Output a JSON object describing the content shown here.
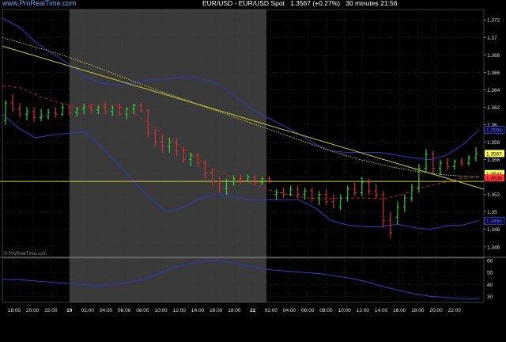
{
  "header": {
    "link": "www.ProRealTime.com",
    "title": "EUR/USD - EUR/USD Spot",
    "last": "1.3567",
    "change": "(+0.27%)",
    "interval": "30 minutes",
    "time": "21:56"
  },
  "watermark": "© ProRealTime.com",
  "y_ticks": [
    "1.372",
    "1.37",
    "1.368",
    "1.366",
    "1.364",
    "1.362",
    "1.36",
    "1.358",
    "1.356",
    "1.354",
    "1.352",
    "1.35",
    "1.348",
    "1.346"
  ],
  "y_tick_values": [
    1.372,
    1.37,
    1.368,
    1.366,
    1.364,
    1.362,
    1.36,
    1.358,
    1.356,
    1.354,
    1.352,
    1.35,
    1.348,
    1.346
  ],
  "price_labels": [
    {
      "text": "1.3567",
      "value": 1.3567,
      "bg": "#ffff66",
      "fg": "#000000"
    },
    {
      "text": "1.3544",
      "value": 1.3544,
      "bg": "#ffff66",
      "fg": "#000000"
    },
    {
      "text": "1.3539",
      "value": 1.3539,
      "bg": "#ff3333",
      "fg": "#000000"
    },
    {
      "text": "1.3594",
      "value": 1.3594,
      "bg": "#000033",
      "fg": "#6666ff"
    },
    {
      "text": "1.3490",
      "value": 1.349,
      "bg": "#000033",
      "fg": "#6666ff"
    }
  ],
  "x_ticks": [
    "18:00",
    "20:00",
    "22:00",
    "19",
    "02:00",
    "04:00",
    "06:00",
    "08:00",
    "10:00",
    "12:00",
    "14:00",
    "16:00",
    "18:00",
    "22",
    "02:00",
    "04:00",
    "06:00",
    "08:00",
    "10:00",
    "12:00",
    "14:00",
    "16:00",
    "18:00",
    "20:00",
    "22:00"
  ],
  "x_tick_bold": [
    false,
    false,
    false,
    true,
    false,
    false,
    false,
    false,
    false,
    false,
    false,
    false,
    false,
    true,
    false,
    false,
    false,
    false,
    false,
    false,
    false,
    false,
    false,
    false,
    false
  ],
  "osc_ticks": [
    "60",
    "50",
    "40",
    "30"
  ],
  "osc_tick_values": [
    60,
    50,
    40,
    30
  ],
  "colors": {
    "up": "#33cc33",
    "down": "#cc3333",
    "bollinger": "#3333bb",
    "moving_average": "#aa2222",
    "trendline": "#cccc33",
    "dotted_ma": "#cccc33",
    "weekend_shade": "#3a3a3a",
    "grid": "#333333"
  },
  "chart_data": {
    "type": "candlestick",
    "instrument": "EUR/USD",
    "interval": "30 minutes",
    "ylim": [
      1.3448,
      1.3732
    ],
    "horizontal_line": 1.3535,
    "bollinger_upper": [
      1.3722,
      1.3712,
      1.3695,
      1.3682,
      1.367,
      1.3655,
      1.3648,
      1.3645,
      1.3648,
      1.3651,
      1.3652,
      1.3655,
      1.3653,
      1.3648,
      1.3635,
      1.362,
      1.3609,
      1.36,
      1.359,
      1.3578,
      1.357,
      1.3568,
      1.3568,
      1.3568,
      1.3565,
      1.3562,
      1.356,
      1.3565,
      1.3577,
      1.3594
    ],
    "bollinger_lower": [
      1.3612,
      1.3596,
      1.3585,
      1.3588,
      1.359,
      1.3592,
      1.3575,
      1.3555,
      1.3535,
      1.3515,
      1.35,
      1.3505,
      1.3516,
      1.352,
      1.3518,
      1.3514,
      1.3514,
      1.3514,
      1.3514,
      1.3505,
      1.349,
      1.3485,
      1.3483,
      1.3483,
      1.3486,
      1.3482,
      1.348,
      1.3484,
      1.3485,
      1.349
    ],
    "moving_average": [
      1.3645,
      1.3642,
      1.3632,
      1.3625,
      1.362,
      1.3623,
      1.3622,
      1.3612,
      1.3596,
      1.358,
      1.3565,
      1.355,
      1.354,
      1.3533,
      1.3525,
      1.352,
      1.3516,
      1.3515,
      1.3516,
      1.3516,
      1.3515,
      1.352,
      1.3528,
      1.3533,
      1.3538,
      1.354
    ],
    "candles": [
      {
        "o": 1.3605,
        "h": 1.3628,
        "l": 1.36,
        "c": 1.3625
      },
      {
        "o": 1.3625,
        "h": 1.3635,
        "l": 1.3615,
        "c": 1.3618
      },
      {
        "o": 1.3618,
        "h": 1.3625,
        "l": 1.3608,
        "c": 1.3612
      },
      {
        "o": 1.3612,
        "h": 1.362,
        "l": 1.3605,
        "c": 1.3615
      },
      {
        "o": 1.3615,
        "h": 1.362,
        "l": 1.3603,
        "c": 1.3608
      },
      {
        "o": 1.3608,
        "h": 1.3618,
        "l": 1.3604,
        "c": 1.361
      },
      {
        "o": 1.361,
        "h": 1.3618,
        "l": 1.3606,
        "c": 1.3614
      },
      {
        "o": 1.3614,
        "h": 1.362,
        "l": 1.3608,
        "c": 1.3612
      },
      {
        "o": 1.3612,
        "h": 1.3624,
        "l": 1.361,
        "c": 1.362
      },
      {
        "o": 1.362,
        "h": 1.3622,
        "l": 1.361,
        "c": 1.3614
      },
      {
        "o": 1.3614,
        "h": 1.362,
        "l": 1.3609,
        "c": 1.3618
      },
      {
        "o": 1.3618,
        "h": 1.3624,
        "l": 1.3612,
        "c": 1.362
      },
      {
        "o": 1.362,
        "h": 1.3624,
        "l": 1.3613,
        "c": 1.3617
      },
      {
        "o": 1.3617,
        "h": 1.3622,
        "l": 1.3612,
        "c": 1.362
      },
      {
        "o": 1.362,
        "h": 1.3626,
        "l": 1.3612,
        "c": 1.3615
      },
      {
        "o": 1.3615,
        "h": 1.3622,
        "l": 1.361,
        "c": 1.362
      },
      {
        "o": 1.362,
        "h": 1.3624,
        "l": 1.361,
        "c": 1.3612
      },
      {
        "o": 1.3612,
        "h": 1.362,
        "l": 1.3606,
        "c": 1.3618
      },
      {
        "o": 1.3618,
        "h": 1.3624,
        "l": 1.3612,
        "c": 1.3622
      },
      {
        "o": 1.3622,
        "h": 1.3626,
        "l": 1.3614,
        "c": 1.3616
      },
      {
        "o": 1.3616,
        "h": 1.3618,
        "l": 1.3585,
        "c": 1.359
      },
      {
        "o": 1.359,
        "h": 1.3595,
        "l": 1.3575,
        "c": 1.358
      },
      {
        "o": 1.358,
        "h": 1.3588,
        "l": 1.3568,
        "c": 1.3575
      },
      {
        "o": 1.3575,
        "h": 1.3585,
        "l": 1.3568,
        "c": 1.358
      },
      {
        "o": 1.358,
        "h": 1.3584,
        "l": 1.3564,
        "c": 1.357
      },
      {
        "o": 1.357,
        "h": 1.3574,
        "l": 1.3556,
        "c": 1.356
      },
      {
        "o": 1.356,
        "h": 1.3568,
        "l": 1.3552,
        "c": 1.3565
      },
      {
        "o": 1.3565,
        "h": 1.3568,
        "l": 1.3552,
        "c": 1.3556
      },
      {
        "o": 1.3556,
        "h": 1.356,
        "l": 1.3538,
        "c": 1.3545
      },
      {
        "o": 1.3545,
        "h": 1.355,
        "l": 1.353,
        "c": 1.3535
      },
      {
        "o": 1.3535,
        "h": 1.354,
        "l": 1.3522,
        "c": 1.3527
      },
      {
        "o": 1.3527,
        "h": 1.3538,
        "l": 1.352,
        "c": 1.3535
      },
      {
        "o": 1.3535,
        "h": 1.3542,
        "l": 1.353,
        "c": 1.3538
      },
      {
        "o": 1.3538,
        "h": 1.3543,
        "l": 1.3532,
        "c": 1.3536
      },
      {
        "o": 1.3536,
        "h": 1.3543,
        "l": 1.3534,
        "c": 1.354
      },
      {
        "o": 1.354,
        "h": 1.3543,
        "l": 1.3532,
        "c": 1.3534
      },
      {
        "o": 1.3534,
        "h": 1.354,
        "l": 1.3531,
        "c": 1.3538
      },
      {
        "o": 1.3538,
        "h": 1.3541,
        "l": 1.3533,
        "c": 1.3536
      },
      {
        "o": 1.352,
        "h": 1.3526,
        "l": 1.3514,
        "c": 1.3522
      },
      {
        "o": 1.3522,
        "h": 1.3528,
        "l": 1.3516,
        "c": 1.352
      },
      {
        "o": 1.352,
        "h": 1.353,
        "l": 1.3518,
        "c": 1.3526
      },
      {
        "o": 1.3526,
        "h": 1.353,
        "l": 1.3516,
        "c": 1.352
      },
      {
        "o": 1.352,
        "h": 1.3528,
        "l": 1.3514,
        "c": 1.3524
      },
      {
        "o": 1.3524,
        "h": 1.3528,
        "l": 1.3512,
        "c": 1.3516
      },
      {
        "o": 1.3516,
        "h": 1.3524,
        "l": 1.3508,
        "c": 1.352
      },
      {
        "o": 1.352,
        "h": 1.3526,
        "l": 1.3508,
        "c": 1.3512
      },
      {
        "o": 1.3512,
        "h": 1.352,
        "l": 1.3504,
        "c": 1.3506
      },
      {
        "o": 1.3506,
        "h": 1.352,
        "l": 1.3502,
        "c": 1.3516
      },
      {
        "o": 1.3516,
        "h": 1.353,
        "l": 1.3512,
        "c": 1.3526
      },
      {
        "o": 1.3526,
        "h": 1.3534,
        "l": 1.3518,
        "c": 1.3522
      },
      {
        "o": 1.3522,
        "h": 1.354,
        "l": 1.3518,
        "c": 1.3534
      },
      {
        "o": 1.3534,
        "h": 1.3538,
        "l": 1.352,
        "c": 1.3524
      },
      {
        "o": 1.3524,
        "h": 1.3532,
        "l": 1.3515,
        "c": 1.352
      },
      {
        "o": 1.352,
        "h": 1.3524,
        "l": 1.3482,
        "c": 1.349
      },
      {
        "o": 1.349,
        "h": 1.35,
        "l": 1.347,
        "c": 1.3476
      },
      {
        "o": 1.3494,
        "h": 1.3512,
        "l": 1.3486,
        "c": 1.3506
      },
      {
        "o": 1.3506,
        "h": 1.352,
        "l": 1.35,
        "c": 1.3516
      },
      {
        "o": 1.3516,
        "h": 1.3532,
        "l": 1.3512,
        "c": 1.3528
      },
      {
        "o": 1.3528,
        "h": 1.3555,
        "l": 1.3522,
        "c": 1.355
      },
      {
        "o": 1.355,
        "h": 1.3572,
        "l": 1.3545,
        "c": 1.3566
      },
      {
        "o": 1.3566,
        "h": 1.357,
        "l": 1.3544,
        "c": 1.355
      },
      {
        "o": 1.355,
        "h": 1.356,
        "l": 1.3542,
        "c": 1.3556
      },
      {
        "o": 1.3556,
        "h": 1.3562,
        "l": 1.3548,
        "c": 1.3552
      },
      {
        "o": 1.3552,
        "h": 1.356,
        "l": 1.3548,
        "c": 1.3558
      },
      {
        "o": 1.3558,
        "h": 1.3562,
        "l": 1.3552,
        "c": 1.3556
      },
      {
        "o": 1.3556,
        "h": 1.3565,
        "l": 1.3553,
        "c": 1.3562
      },
      {
        "o": 1.3562,
        "h": 1.3574,
        "l": 1.3558,
        "c": 1.3567
      }
    ],
    "oscillator": {
      "ylim": [
        25,
        62
      ],
      "values": [
        44,
        44,
        43,
        42,
        41,
        40,
        39,
        40,
        42,
        45,
        50,
        55,
        58,
        60,
        59,
        57,
        54,
        52,
        51,
        50,
        49,
        47,
        45,
        42,
        38,
        35,
        32,
        30,
        29,
        28,
        28
      ]
    }
  }
}
